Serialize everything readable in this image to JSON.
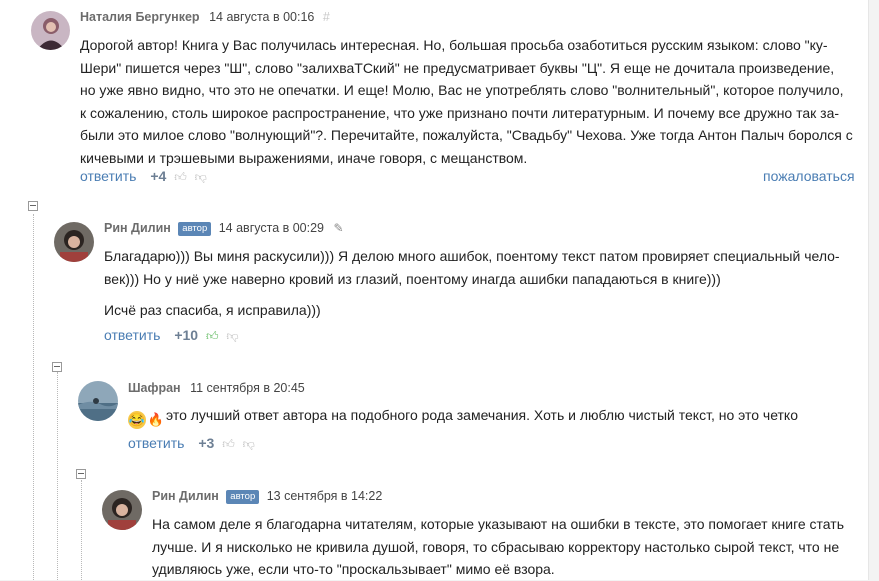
{
  "comments": [
    {
      "author": "Наталия Бергункер",
      "date": "14 августа в 00:16",
      "hash": "#",
      "lines": [
        "Дорогой автор! Книга у Вас получилась интересная. Но, большая просьба озаботиться русским языком: слово \"ку-",
        "Шери\" пишется через \"Ш\", слово \"залихваТСкий\" не предусматривает буквы \"Ц\". Я еще не дочитала произведение,",
        "но уже явно видно, что это не опечатки. И еще! Молю, Вас не употреблять слово \"волнительный\", которое получило,",
        "к сожалению, столь широкое распространение, что уже признано почти литературным. И почему все дружно так за-",
        "были это милое слово \"волнующий\"?. Перечитайте, пожалуйста, \"Свадьбу\" Чехова. Уже тогда Антон Палыч боролся с",
        "кичевыми и трэшевыми выражениями, иначе говоря, с мещанством."
      ],
      "reply_label": "ответить",
      "score": "+4",
      "report_label": "пожаловаться"
    },
    {
      "author": "Рин Дилин",
      "badge": "автор",
      "date": "14 августа в 00:29",
      "lines": [
        "Благадарю))) Вы миня раскусили))) Я делою много ашибок, поентому текст патом провиряет специальный чело-",
        "век))) Но у ниё уже наверно кровий из глазий, поентому инагда ашибки пападаються в книге)))"
      ],
      "lines2": [
        "Исчё раз спасиба, я исправила)))"
      ],
      "reply_label": "ответить",
      "score": "+10"
    },
    {
      "author": "Шафран",
      "date": "11 сентября в 20:45",
      "text": "это лучший ответ автора на подобного рода замечания. Хоть и люблю чистый текст, но это четко",
      "reply_label": "ответить",
      "score": "+3"
    },
    {
      "author": "Рин Дилин",
      "badge": "автор",
      "date": "13 сентября в 14:22",
      "lines": [
        "На самом деле я благодарна читателям, которые указывают на ошибки в тексте, это помогает книге стать",
        "лучше. И я нисколько не кривила душой, говоря, то сбрасываю корректору настолько сырой текст, что не",
        "удивляюсь уже, если что-то \"проскальзывает\" мимо её взора."
      ]
    }
  ],
  "icons": {
    "thumb_up": "thumb-up-icon",
    "thumb_down": "thumb-down-icon",
    "edit": "pencil-icon",
    "collapse": "collapse-icon"
  },
  "colors": {
    "link": "#4a7db3",
    "badge": "#5b86b6",
    "liked": "#5cb85c"
  }
}
